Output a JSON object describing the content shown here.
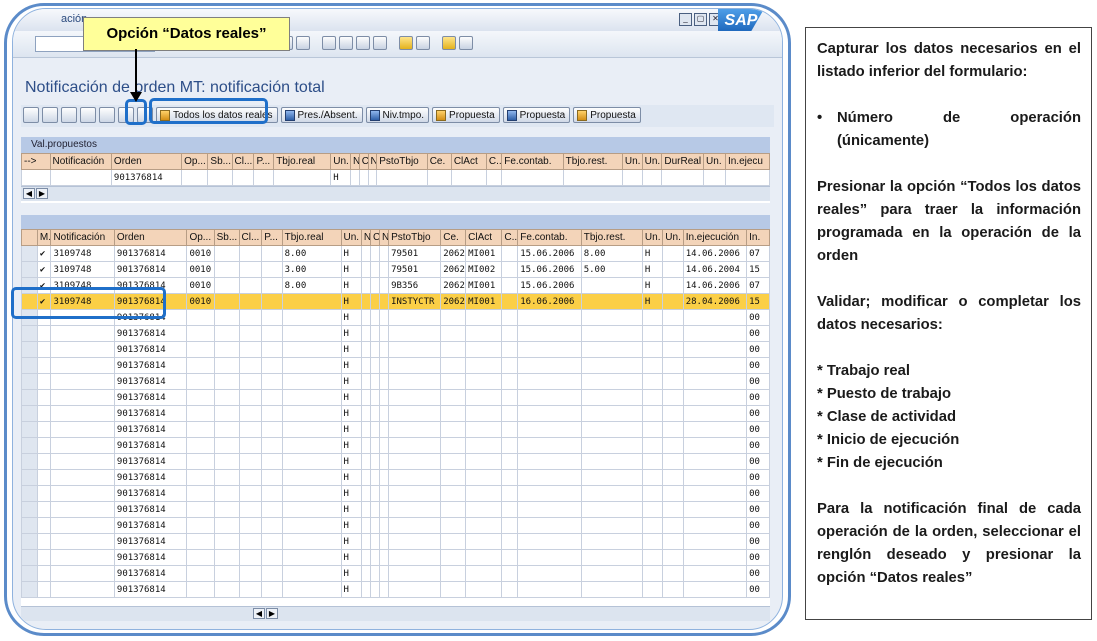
{
  "window": {
    "menu_fragment": "ación",
    "logo": "SAP",
    "win_buttons": [
      "_",
      "▢",
      "✕"
    ]
  },
  "callout": {
    "label": "Opción “Datos reales”"
  },
  "page": {
    "title": "Notificación de orden MT: notificación total"
  },
  "app_toolbar": {
    "buttons": [
      "Todos los datos reales",
      "Pres./Absent.",
      "Niv.tmpo.",
      "Propuesta",
      "Propuesta",
      "Propuesta"
    ]
  },
  "proposed": {
    "title": "Val.propuestos",
    "headers": [
      "-->",
      "Notificación",
      "Orden",
      "Op...",
      "Sb...",
      "Cl...",
      "P...",
      "Tbjo.real",
      "Un.",
      "N",
      "C",
      "N",
      "PstoTbjo",
      "Ce.",
      "ClAct",
      "C..",
      "Fe.contab.",
      "Tbjo.rest.",
      "Un.",
      "Un.",
      "DurReal",
      "Un.",
      "In.ejecu"
    ],
    "row": [
      "",
      "",
      "901376814",
      "",
      "",
      "",
      "",
      "",
      "H",
      "",
      "",
      "",
      "",
      "",
      "",
      "",
      "",
      "",
      "",
      "",
      "",
      "",
      ""
    ]
  },
  "main": {
    "headers": [
      "M..",
      "Notificación",
      "Orden",
      "Op...",
      "Sb...",
      "Cl...",
      "P...",
      "Tbjo.real",
      "Un.",
      "N",
      "C",
      "N",
      "PstoTbjo",
      "Ce.",
      "ClAct",
      "C..",
      "Fe.contab.",
      "Tbjo.rest.",
      "Un.",
      "Un.",
      "In.ejecución",
      "In."
    ],
    "rows": [
      {
        "check": true,
        "cells": [
          "3109748",
          "901376814",
          "0010",
          "",
          "",
          "",
          "8.00",
          "H",
          "",
          "",
          "",
          "79501",
          "2062",
          "MI001",
          "",
          "15.06.2006",
          "8.00",
          "H",
          "",
          "14.06.2006",
          "07"
        ]
      },
      {
        "check": true,
        "cells": [
          "3109748",
          "901376814",
          "0010",
          "",
          "",
          "",
          "3.00",
          "H",
          "",
          "",
          "",
          "79501",
          "2062",
          "MI002",
          "",
          "15.06.2006",
          "5.00",
          "H",
          "",
          "14.06.2004",
          "15"
        ]
      },
      {
        "check": true,
        "cells": [
          "3109748",
          "901376814",
          "0010",
          "",
          "",
          "",
          "8.00",
          "H",
          "",
          "",
          "",
          "9B356",
          "2062",
          "MI001",
          "",
          "15.06.2006",
          "",
          "H",
          "",
          "14.06.2006",
          "07"
        ]
      },
      {
        "check": true,
        "selected": true,
        "cells": [
          "3109748",
          "901376814",
          "0010",
          "",
          "",
          "",
          "",
          "H",
          "",
          "",
          "",
          "INSTYCTR",
          "2062",
          "MI001",
          "",
          "16.06.2006",
          "",
          "H",
          "",
          "28.04.2006",
          "15"
        ]
      },
      {
        "cells": [
          "",
          "901376814",
          "",
          "",
          "",
          "",
          "",
          "H",
          "",
          "",
          "",
          "",
          "",
          "",
          "",
          "",
          "",
          "",
          "",
          "",
          "00"
        ]
      },
      {
        "cells": [
          "",
          "901376814",
          "",
          "",
          "",
          "",
          "",
          "H",
          "",
          "",
          "",
          "",
          "",
          "",
          "",
          "",
          "",
          "",
          "",
          "",
          "00"
        ]
      },
      {
        "cells": [
          "",
          "901376814",
          "",
          "",
          "",
          "",
          "",
          "H",
          "",
          "",
          "",
          "",
          "",
          "",
          "",
          "",
          "",
          "",
          "",
          "",
          "00"
        ]
      },
      {
        "cells": [
          "",
          "901376814",
          "",
          "",
          "",
          "",
          "",
          "H",
          "",
          "",
          "",
          "",
          "",
          "",
          "",
          "",
          "",
          "",
          "",
          "",
          "00"
        ]
      },
      {
        "cells": [
          "",
          "901376814",
          "",
          "",
          "",
          "",
          "",
          "H",
          "",
          "",
          "",
          "",
          "",
          "",
          "",
          "",
          "",
          "",
          "",
          "",
          "00"
        ]
      },
      {
        "cells": [
          "",
          "901376814",
          "",
          "",
          "",
          "",
          "",
          "H",
          "",
          "",
          "",
          "",
          "",
          "",
          "",
          "",
          "",
          "",
          "",
          "",
          "00"
        ]
      },
      {
        "cells": [
          "",
          "901376814",
          "",
          "",
          "",
          "",
          "",
          "H",
          "",
          "",
          "",
          "",
          "",
          "",
          "",
          "",
          "",
          "",
          "",
          "",
          "00"
        ]
      },
      {
        "cells": [
          "",
          "901376814",
          "",
          "",
          "",
          "",
          "",
          "H",
          "",
          "",
          "",
          "",
          "",
          "",
          "",
          "",
          "",
          "",
          "",
          "",
          "00"
        ]
      },
      {
        "cells": [
          "",
          "901376814",
          "",
          "",
          "",
          "",
          "",
          "H",
          "",
          "",
          "",
          "",
          "",
          "",
          "",
          "",
          "",
          "",
          "",
          "",
          "00"
        ]
      },
      {
        "cells": [
          "",
          "901376814",
          "",
          "",
          "",
          "",
          "",
          "H",
          "",
          "",
          "",
          "",
          "",
          "",
          "",
          "",
          "",
          "",
          "",
          "",
          "00"
        ]
      },
      {
        "cells": [
          "",
          "901376814",
          "",
          "",
          "",
          "",
          "",
          "H",
          "",
          "",
          "",
          "",
          "",
          "",
          "",
          "",
          "",
          "",
          "",
          "",
          "00"
        ]
      },
      {
        "cells": [
          "",
          "901376814",
          "",
          "",
          "",
          "",
          "",
          "H",
          "",
          "",
          "",
          "",
          "",
          "",
          "",
          "",
          "",
          "",
          "",
          "",
          "00"
        ]
      },
      {
        "cells": [
          "",
          "901376814",
          "",
          "",
          "",
          "",
          "",
          "H",
          "",
          "",
          "",
          "",
          "",
          "",
          "",
          "",
          "",
          "",
          "",
          "",
          "00"
        ]
      },
      {
        "cells": [
          "",
          "901376814",
          "",
          "",
          "",
          "",
          "",
          "H",
          "",
          "",
          "",
          "",
          "",
          "",
          "",
          "",
          "",
          "",
          "",
          "",
          "00"
        ]
      },
      {
        "cells": [
          "",
          "901376814",
          "",
          "",
          "",
          "",
          "",
          "H",
          "",
          "",
          "",
          "",
          "",
          "",
          "",
          "",
          "",
          "",
          "",
          "",
          "00"
        ]
      },
      {
        "cells": [
          "",
          "901376814",
          "",
          "",
          "",
          "",
          "",
          "H",
          "",
          "",
          "",
          "",
          "",
          "",
          "",
          "",
          "",
          "",
          "",
          "",
          "00"
        ]
      },
      {
        "cells": [
          "",
          "901376814",
          "",
          "",
          "",
          "",
          "",
          "H",
          "",
          "",
          "",
          "",
          "",
          "",
          "",
          "",
          "",
          "",
          "",
          "",
          "00"
        ]
      },
      {
        "cells": [
          "",
          "901376814",
          "",
          "",
          "",
          "",
          "",
          "H",
          "",
          "",
          "",
          "",
          "",
          "",
          "",
          "",
          "",
          "",
          "",
          "",
          "00"
        ]
      }
    ]
  },
  "instructions": {
    "p1": "Capturar los datos necesarios en el listado inferior del formulario:",
    "bullet": "Número de operación (únicamente)",
    "p2": "Presionar la opción “Todos los datos reales” para traer la información programada en la operación de la orden",
    "p3": "Validar; modificar o completar los datos necesarios:",
    "items": [
      "* Trabajo real",
      "* Puesto de trabajo",
      "* Clase de actividad",
      "* Inicio de ejecución",
      "* Fin de ejecución"
    ],
    "p4": "Para la notificación final de cada operación de la orden, seleccionar el renglón deseado y presionar la opción “Datos reales”"
  }
}
